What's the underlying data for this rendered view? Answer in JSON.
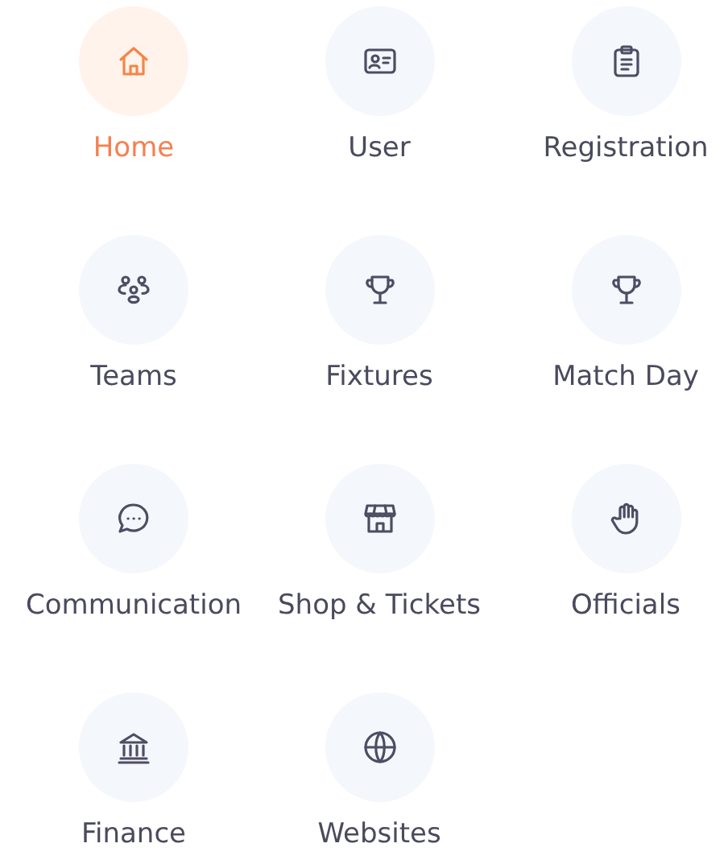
{
  "menu": [
    {
      "label": "Home",
      "selected": true
    },
    {
      "label": "User",
      "selected": false
    },
    {
      "label": "Registration",
      "selected": false
    },
    {
      "label": "Teams",
      "selected": false
    },
    {
      "label": "Fixtures",
      "selected": false
    },
    {
      "label": "Match Day",
      "selected": false
    },
    {
      "label": "Communication",
      "selected": false
    },
    {
      "label": "Shop & Tickets",
      "selected": false
    },
    {
      "label": "Officials",
      "selected": false
    },
    {
      "label": "Finance",
      "selected": false
    },
    {
      "label": "Websites",
      "selected": false
    }
  ]
}
